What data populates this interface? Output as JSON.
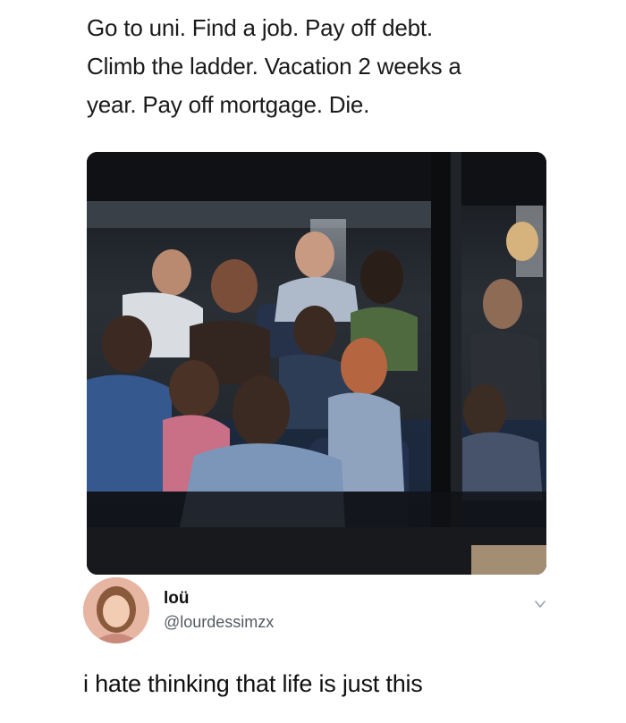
{
  "caption": {
    "lines": [
      "Go to uni. Find a job. Pay off debt.",
      "Climb the ladder. Vacation 2 weeks a",
      "year. Pay off mortgage. Die."
    ]
  },
  "tweet": {
    "display_name": "loü",
    "handle": "@lourdessimzx",
    "text": "i hate thinking that life is just this",
    "menu_icon": "chevron-down-icon"
  },
  "colors": {
    "text": "#111111",
    "handle": "#555b61",
    "photo_dark": "#1b1e22"
  }
}
